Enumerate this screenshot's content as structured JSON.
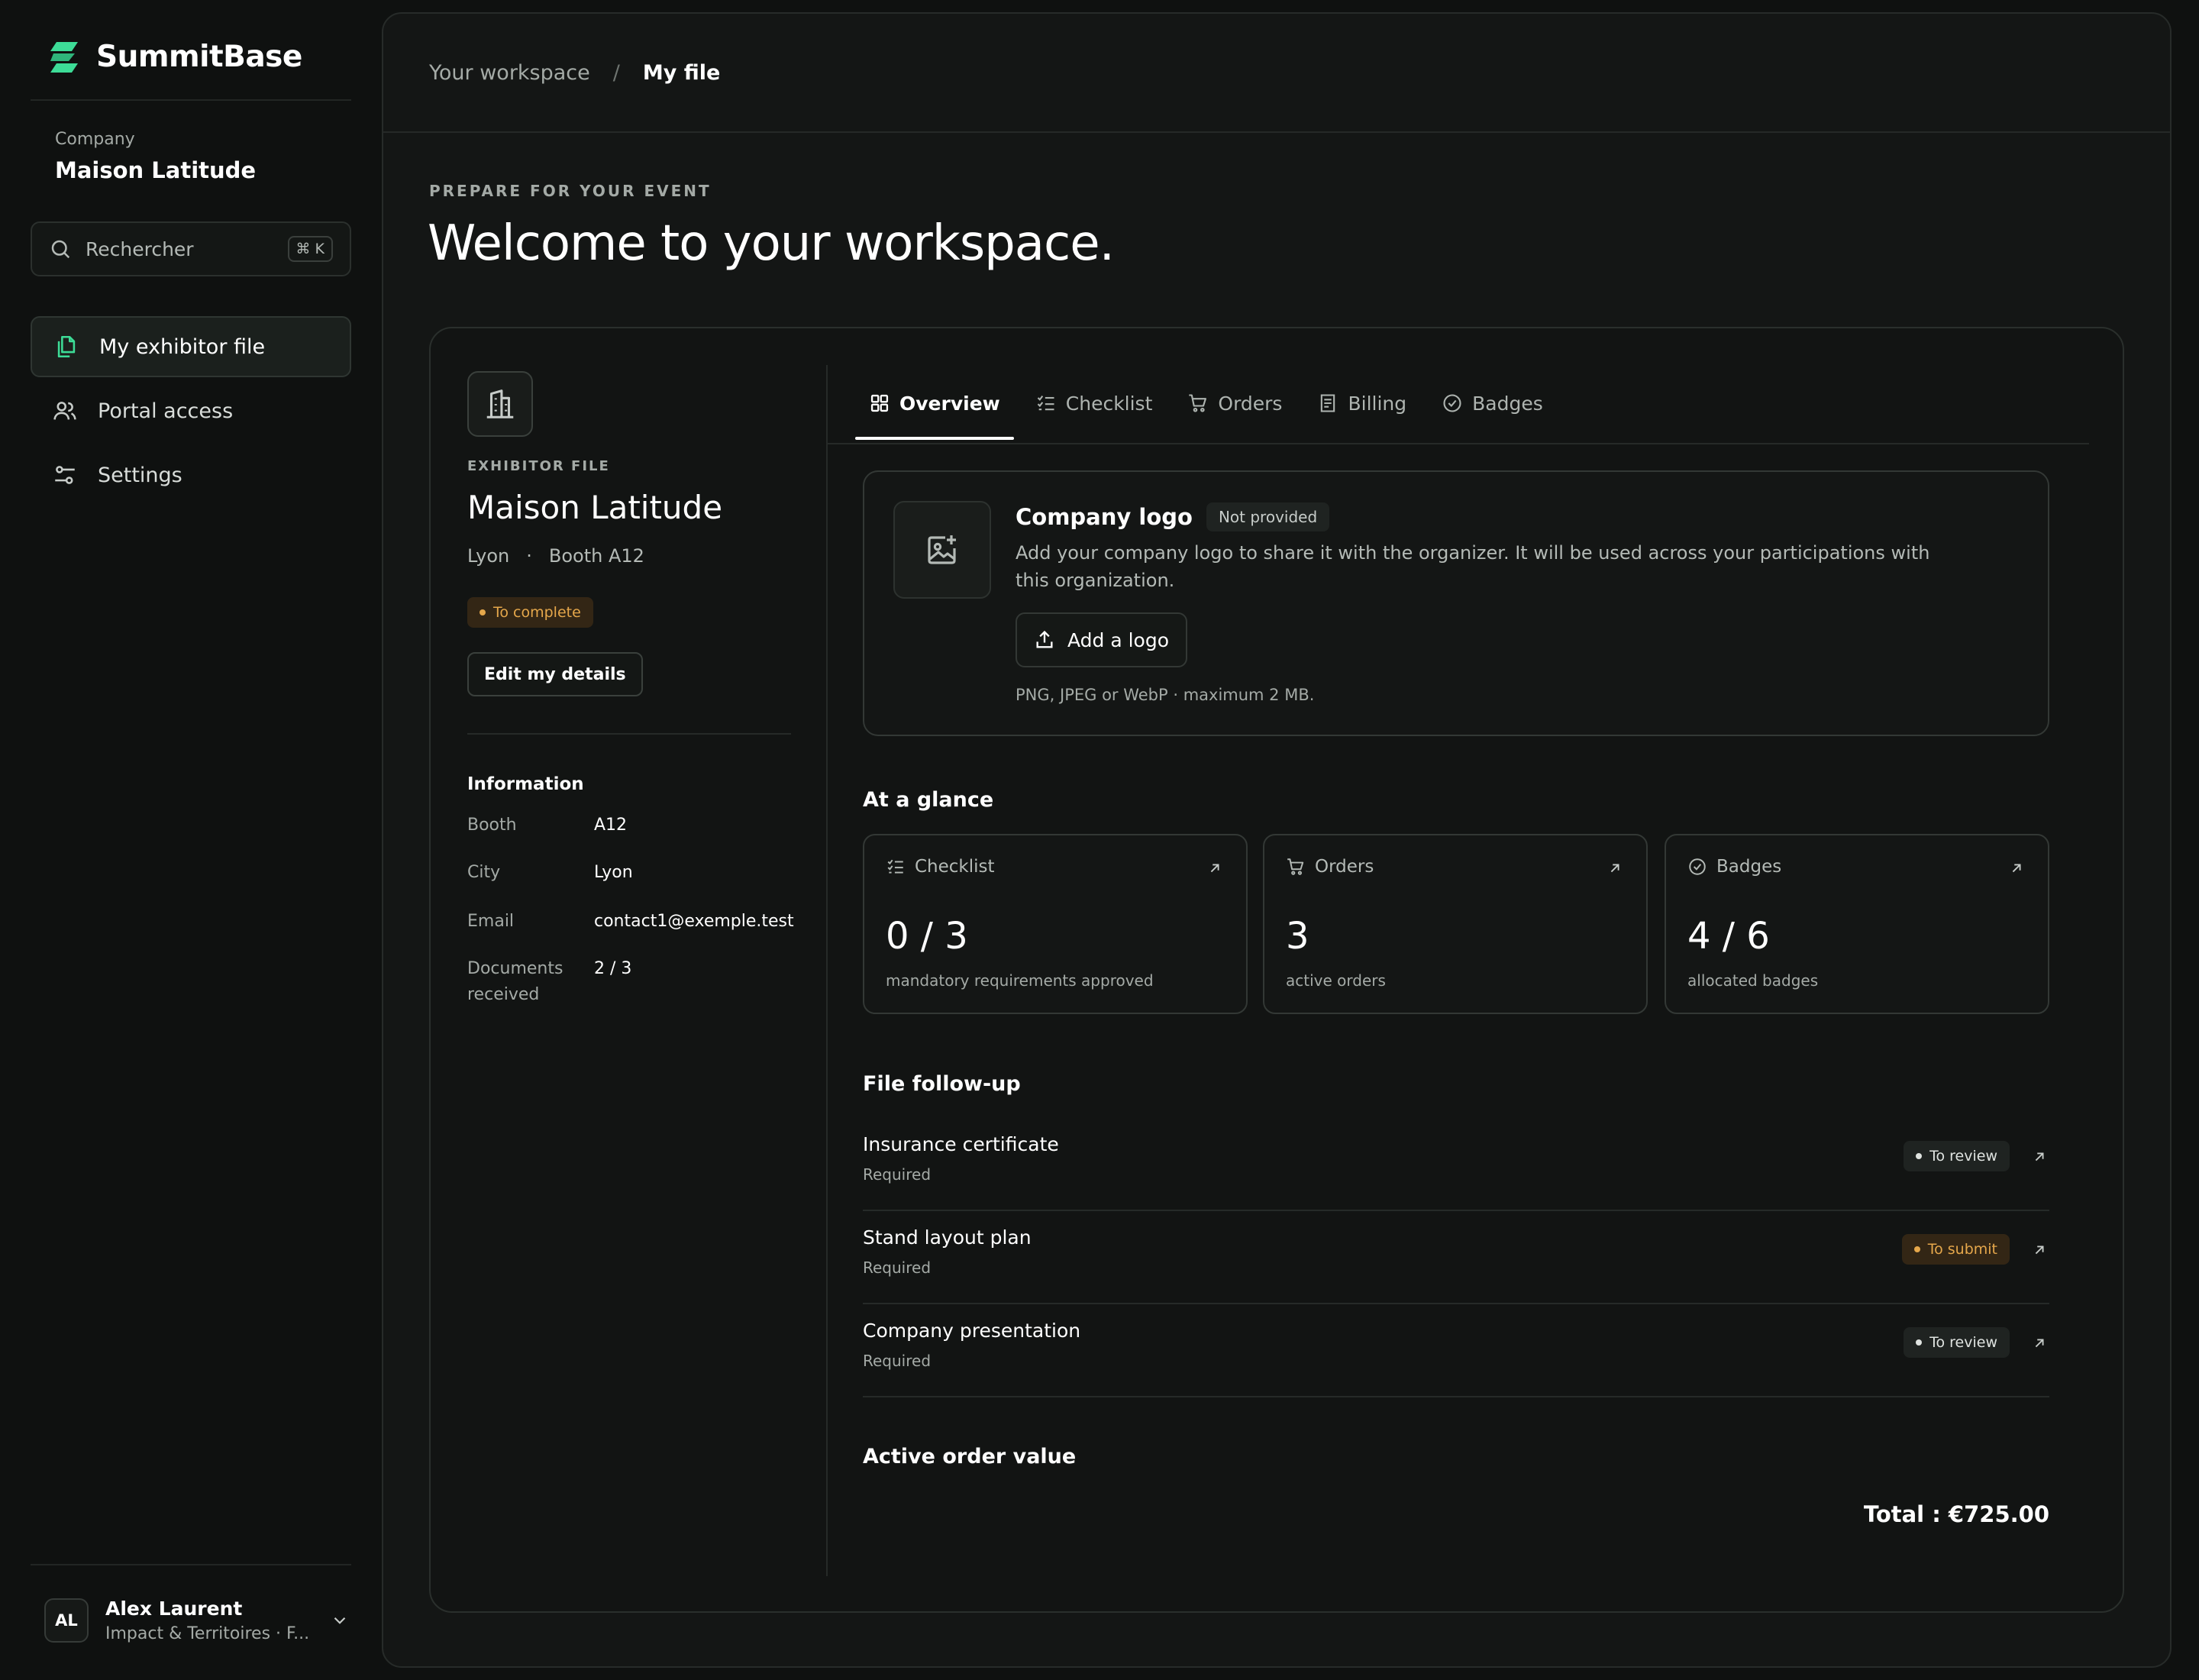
{
  "app": {
    "name": "SummitBase"
  },
  "company": {
    "label": "Company",
    "name": "Maison Latitude"
  },
  "search": {
    "placeholder": "Rechercher",
    "shortcut": "⌘ K"
  },
  "nav": [
    {
      "label": "My exhibitor file",
      "icon": "documents-icon",
      "active": true
    },
    {
      "label": "Portal access",
      "icon": "users-icon",
      "active": false
    },
    {
      "label": "Settings",
      "icon": "sliders-icon",
      "active": false
    }
  ],
  "user": {
    "initials": "AL",
    "name": "Alex Laurent",
    "org": "Impact & Territoires · F..."
  },
  "breadcrumb": {
    "first": "Your workspace",
    "separator": "/",
    "current": "My file"
  },
  "header": {
    "kicker": "PREPARE FOR YOUR EVENT",
    "title": "Welcome to your workspace."
  },
  "exhibitor": {
    "label": "EXHIBITOR FILE",
    "name": "Maison Latitude",
    "city": "Lyon",
    "dot": "·",
    "booth": "Booth A12",
    "status": "To complete",
    "edit_label": "Edit my details",
    "info_title": "Information",
    "info": [
      {
        "key": "Booth",
        "value": "A12"
      },
      {
        "key": "City",
        "value": "Lyon"
      },
      {
        "key": "Email",
        "value": "contact1@exemple.test"
      },
      {
        "key": "Documents received",
        "value": "2 / 3"
      }
    ]
  },
  "tabs": [
    {
      "label": "Overview",
      "icon": "grid-icon",
      "active": true
    },
    {
      "label": "Checklist",
      "icon": "checklist-icon",
      "active": false
    },
    {
      "label": "Orders",
      "icon": "cart-icon",
      "active": false
    },
    {
      "label": "Billing",
      "icon": "receipt-icon",
      "active": false
    },
    {
      "label": "Badges",
      "icon": "badge-check-icon",
      "active": false
    }
  ],
  "logo_card": {
    "title": "Company logo",
    "status": "Not provided",
    "description": "Add your company logo to share it with the organizer. It will be used across your participations with this organization.",
    "button": "Add a logo",
    "hint": "PNG, JPEG or WebP · maximum 2 MB."
  },
  "glance": {
    "title": "At a glance",
    "cards": [
      {
        "label": "Checklist",
        "icon": "checklist-icon",
        "value": "0 / 3",
        "caption": "mandatory requirements approved"
      },
      {
        "label": "Orders",
        "icon": "cart-icon",
        "value": "3",
        "caption": "active orders"
      },
      {
        "label": "Badges",
        "icon": "badge-check-icon",
        "value": "4 / 6",
        "caption": "allocated badges"
      }
    ]
  },
  "followup": {
    "title": "File follow-up",
    "items": [
      {
        "title": "Insurance certificate",
        "subtitle": "Required",
        "status": "To review",
        "tone": "neutral"
      },
      {
        "title": "Stand layout plan",
        "subtitle": "Required",
        "status": "To submit",
        "tone": "warn"
      },
      {
        "title": "Company presentation",
        "subtitle": "Required",
        "status": "To review",
        "tone": "neutral"
      }
    ]
  },
  "orders": {
    "title": "Active order value",
    "total": "Total : €725.00"
  },
  "colors": {
    "brand": "#3ddc97",
    "warn": "#e5a74b",
    "background": "#0f1110"
  }
}
